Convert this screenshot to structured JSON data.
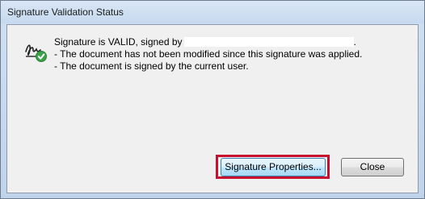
{
  "window": {
    "title": "Signature Validation Status"
  },
  "message": {
    "line1": "Signature is VALID, signed by",
    "line1_end": ".",
    "line2": "- The document has not been modified since this signature was applied.",
    "line3": "- The document is signed by the current user."
  },
  "buttons": {
    "properties_label": "Signature Properties...",
    "close_label": "Close"
  },
  "icon": {
    "name": "signature-valid-icon",
    "check_color": "#3aa34a"
  }
}
